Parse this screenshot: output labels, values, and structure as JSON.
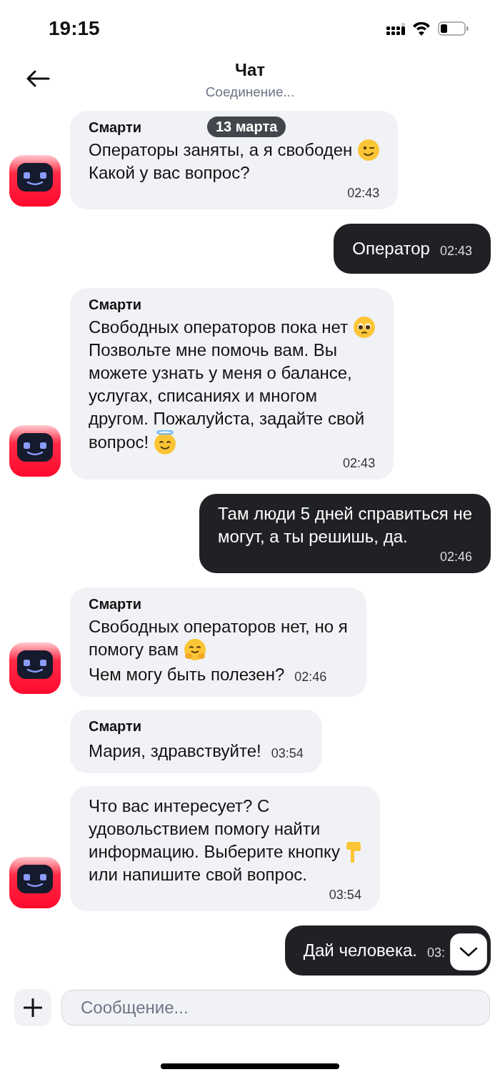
{
  "status_bar": {
    "time": "19:15"
  },
  "header": {
    "title": "Чат",
    "subtitle": "Соединение..."
  },
  "date_badge": "13 марта",
  "messages": [
    {
      "kind": "incoming",
      "sender": "Смарти",
      "avatar": true,
      "time_inline": false,
      "lines": [
        {
          "text": "Операторы заняты, а я свободен",
          "emoji": true
        },
        {
          "text": "Какой у вас вопрос?",
          "emoji": false
        }
      ],
      "time": "02:43"
    },
    {
      "kind": "outgoing",
      "time_inline": true,
      "lines": [
        {
          "text": "Оператор",
          "emoji": false
        }
      ],
      "time": "02:43"
    },
    {
      "kind": "incoming",
      "sender": "Смарти",
      "avatar": true,
      "time_inline": false,
      "lines": [
        {
          "text": "Свободных операторов пока нет",
          "emoji": true
        },
        {
          "text": "Позвольте мне помочь вам. Вы",
          "emoji": false
        },
        {
          "text": "можете узнать у меня о балансе,",
          "emoji": false
        },
        {
          "text": "услугах, списаниях и многом",
          "emoji": false
        },
        {
          "text": "другом. Пожалуйста, задайте свой",
          "emoji": false
        },
        {
          "text": "вопрос!",
          "emoji": true
        }
      ],
      "time": "02:43"
    },
    {
      "kind": "outgoing",
      "time_inline": false,
      "lines": [
        {
          "text": "Там люди 5 дней справиться не",
          "emoji": false
        },
        {
          "text": "могут, а ты решишь, да.",
          "emoji": false
        }
      ],
      "time": "02:46"
    },
    {
      "kind": "incoming",
      "sender": "Смарти",
      "avatar": true,
      "time_inline": true,
      "lines": [
        {
          "text": "Свободных операторов нет, но я",
          "emoji": false
        },
        {
          "text": "помогу вам",
          "emoji": true
        },
        {
          "text": "Чем могу быть полезен?",
          "emoji": false
        }
      ],
      "time": "02:46"
    },
    {
      "kind": "incoming",
      "sender": "Смарти",
      "avatar": false,
      "time_inline": true,
      "lines": [
        {
          "text": "Мария, здравствуйте!",
          "emoji": false
        }
      ],
      "time": "03:54"
    },
    {
      "kind": "incoming",
      "avatar": true,
      "time_inline": false,
      "lines": [
        {
          "text": "Что вас интересует? С",
          "emoji": false
        },
        {
          "text": "удовольствием помогу найти",
          "emoji": false
        },
        {
          "text": "информацию. Выберите кнопку",
          "emoji": true
        },
        {
          "text": "или напишите свой вопрос.",
          "emoji": false
        }
      ],
      "time": "03:54"
    },
    {
      "kind": "outgoing",
      "time_inline": true,
      "lines": [
        {
          "text": "Дай человека.",
          "emoji": false
        }
      ],
      "time": "03:"
    }
  ],
  "composer": {
    "placeholder": "Сообщение..."
  }
}
